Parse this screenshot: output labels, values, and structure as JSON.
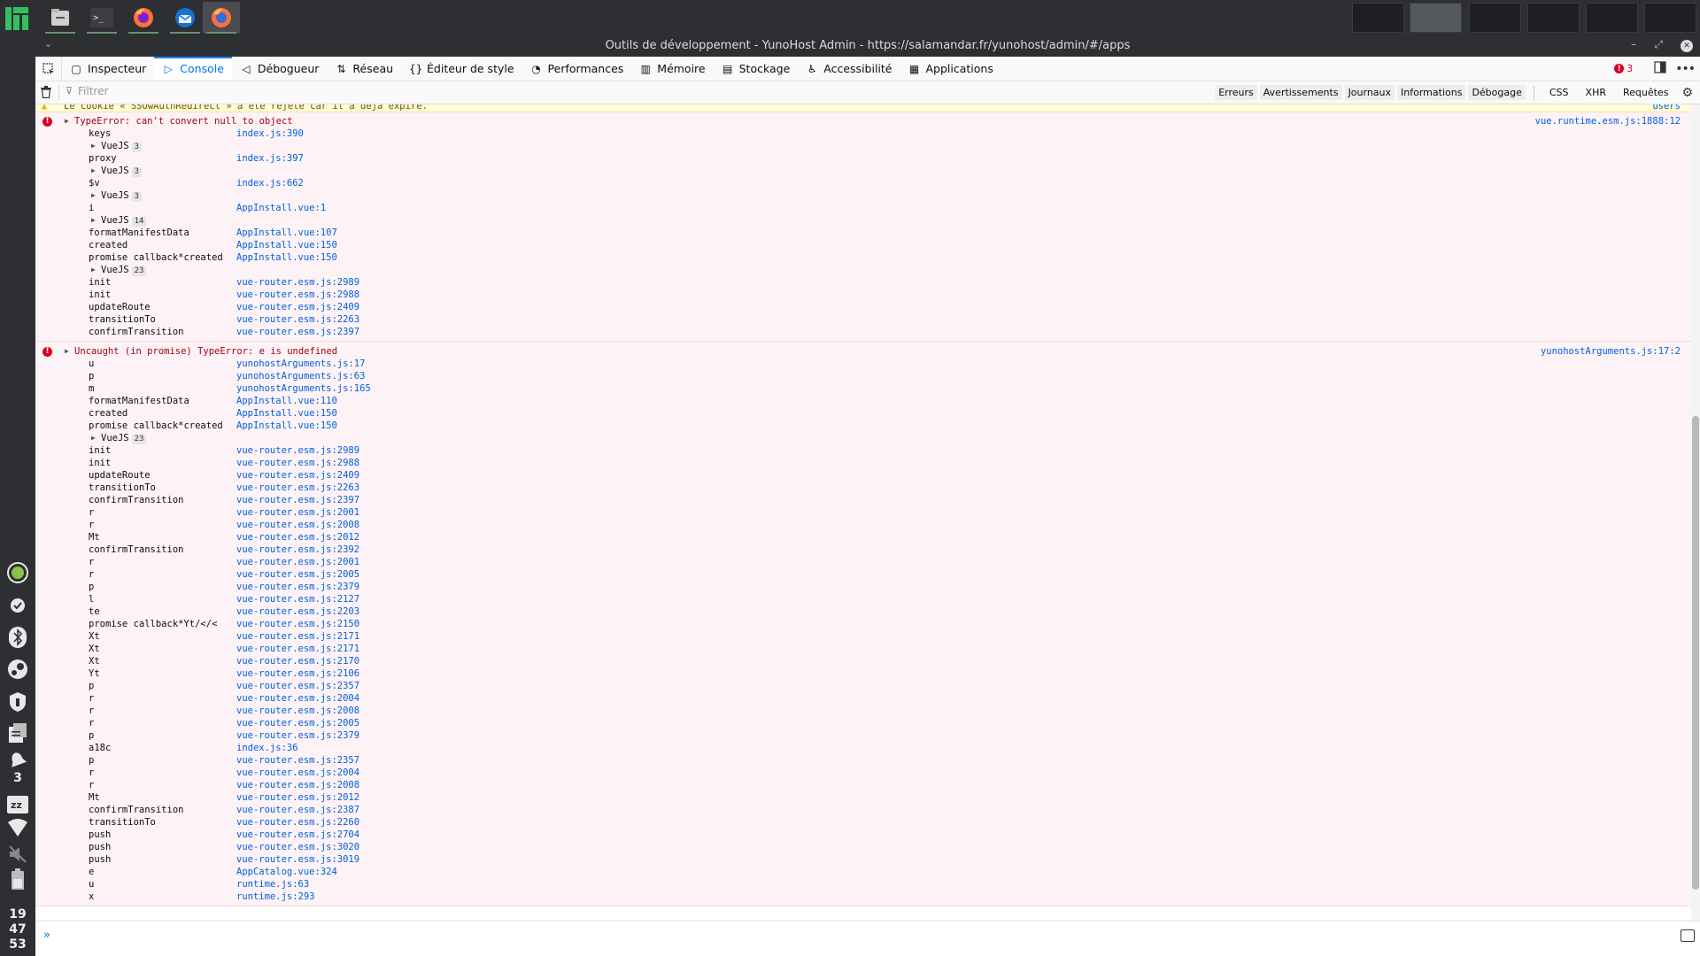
{
  "taskbar": {
    "apps": [
      {
        "name": "files-icon"
      },
      {
        "name": "terminal-icon",
        "glyph": ">_"
      },
      {
        "name": "firefox-icon"
      },
      {
        "name": "thunderbird-icon"
      },
      {
        "name": "firefox-dev-icon"
      }
    ],
    "workspaces": 6
  },
  "dock": {
    "icons": [
      "update-icon",
      "check-icon",
      "bluetooth-icon",
      "steam-icon",
      "vpn-icon",
      "clipboard-icon",
      "notifications-icon",
      "keyboard-icon",
      "wifi-icon",
      "mute-icon",
      "battery-icon"
    ],
    "notif_count": "3",
    "clock": {
      "h": "19",
      "m": "47",
      "s": "53"
    }
  },
  "window": {
    "title": "Outils de développement - YunoHost Admin - https://salamandar.fr/yunohost/admin/#/apps",
    "buttons": {
      "minimize": "–",
      "maximize": "⤢",
      "close": "✕"
    }
  },
  "toolbar": {
    "tabs": [
      {
        "label": "Inspecteur",
        "icon": "▢",
        "name": "tab-inspector"
      },
      {
        "label": "Console",
        "icon": "▷",
        "name": "tab-console",
        "selected": true
      },
      {
        "label": "Débogueur",
        "icon": "◁",
        "name": "tab-debugger"
      },
      {
        "label": "Réseau",
        "icon": "⇅",
        "name": "tab-network"
      },
      {
        "label": "Éditeur de style",
        "icon": "{}",
        "name": "tab-style-editor"
      },
      {
        "label": "Performances",
        "icon": "◔",
        "name": "tab-performance"
      },
      {
        "label": "Mémoire",
        "icon": "▥",
        "name": "tab-memory"
      },
      {
        "label": "Stockage",
        "icon": "▤",
        "name": "tab-storage"
      },
      {
        "label": "Accessibilité",
        "icon": "♿",
        "name": "tab-accessibility"
      },
      {
        "label": "Applications",
        "icon": "▦",
        "name": "tab-applications"
      }
    ],
    "error_count": "3"
  },
  "filter": {
    "placeholder": "Filtrer",
    "levels": [
      {
        "label": "Erreurs",
        "on": true
      },
      {
        "label": "Avertissements",
        "on": true
      },
      {
        "label": "Journaux",
        "on": true
      },
      {
        "label": "Informations",
        "on": true
      },
      {
        "label": "Débogage",
        "on": true
      }
    ],
    "extra": [
      "CSS",
      "XHR",
      "Requêtes"
    ]
  },
  "console": {
    "warning": {
      "text": "Le cookie « SSOwAuthRedirect » a été rejeté car il a déjà expiré.",
      "source": "users"
    },
    "errors": [
      {
        "message": "TypeError: can't convert null to object",
        "source": "vue.runtime.esm.js:1888:12",
        "frames": [
          {
            "fn": "keys",
            "src": "index.js:390"
          },
          {
            "group": "VueJS",
            "count": "3"
          },
          {
            "fn": "proxy",
            "src": "index.js:397"
          },
          {
            "group": "VueJS",
            "count": "3"
          },
          {
            "fn": "$v",
            "src": "index.js:662"
          },
          {
            "group": "VueJS",
            "count": "3"
          },
          {
            "fn": "i",
            "src": "AppInstall.vue:1"
          },
          {
            "group": "VueJS",
            "count": "14"
          },
          {
            "fn": "formatManifestData",
            "src": "AppInstall.vue:107"
          },
          {
            "fn": "created",
            "src": "AppInstall.vue:150"
          },
          {
            "fn": "promise callback*created",
            "src": "AppInstall.vue:150"
          },
          {
            "group": "VueJS",
            "count": "23"
          },
          {
            "fn": "init",
            "src": "vue-router.esm.js:2989"
          },
          {
            "fn": "init",
            "src": "vue-router.esm.js:2988"
          },
          {
            "fn": "updateRoute",
            "src": "vue-router.esm.js:2409"
          },
          {
            "fn": "transitionTo",
            "src": "vue-router.esm.js:2263"
          },
          {
            "fn": "confirmTransition",
            "src": "vue-router.esm.js:2397"
          }
        ]
      },
      {
        "message": "Uncaught (in promise) TypeError: e is undefined",
        "source": "yunohostArguments.js:17:2",
        "frames": [
          {
            "fn": "u",
            "src": "yunohostArguments.js:17"
          },
          {
            "fn": "p",
            "src": "yunohostArguments.js:63"
          },
          {
            "fn": "m",
            "src": "yunohostArguments.js:165"
          },
          {
            "fn": "formatManifestData",
            "src": "AppInstall.vue:110"
          },
          {
            "fn": "created",
            "src": "AppInstall.vue:150"
          },
          {
            "fn": "promise callback*created",
            "src": "AppInstall.vue:150"
          },
          {
            "group": "VueJS",
            "count": "23"
          },
          {
            "fn": "init",
            "src": "vue-router.esm.js:2989"
          },
          {
            "fn": "init",
            "src": "vue-router.esm.js:2988"
          },
          {
            "fn": "updateRoute",
            "src": "vue-router.esm.js:2409"
          },
          {
            "fn": "transitionTo",
            "src": "vue-router.esm.js:2263"
          },
          {
            "fn": "confirmTransition",
            "src": "vue-router.esm.js:2397"
          },
          {
            "fn": "r",
            "src": "vue-router.esm.js:2001"
          },
          {
            "fn": "r",
            "src": "vue-router.esm.js:2008"
          },
          {
            "fn": "Mt",
            "src": "vue-router.esm.js:2012"
          },
          {
            "fn": "confirmTransition",
            "src": "vue-router.esm.js:2392"
          },
          {
            "fn": "r",
            "src": "vue-router.esm.js:2001"
          },
          {
            "fn": "r",
            "src": "vue-router.esm.js:2005"
          },
          {
            "fn": "p",
            "src": "vue-router.esm.js:2379"
          },
          {
            "fn": "l",
            "src": "vue-router.esm.js:2127"
          },
          {
            "fn": "te",
            "src": "vue-router.esm.js:2203"
          },
          {
            "fn": "promise callback*Yt/</<",
            "src": "vue-router.esm.js:2150"
          },
          {
            "fn": "Xt",
            "src": "vue-router.esm.js:2171"
          },
          {
            "fn": "Xt",
            "src": "vue-router.esm.js:2171"
          },
          {
            "fn": "Xt",
            "src": "vue-router.esm.js:2170"
          },
          {
            "fn": "Yt",
            "src": "vue-router.esm.js:2106"
          },
          {
            "fn": "p",
            "src": "vue-router.esm.js:2357"
          },
          {
            "fn": "r",
            "src": "vue-router.esm.js:2004"
          },
          {
            "fn": "r",
            "src": "vue-router.esm.js:2008"
          },
          {
            "fn": "r",
            "src": "vue-router.esm.js:2005"
          },
          {
            "fn": "p",
            "src": "vue-router.esm.js:2379"
          },
          {
            "fn": "a18c",
            "src": "index.js:36"
          },
          {
            "fn": "p",
            "src": "vue-router.esm.js:2357"
          },
          {
            "fn": "r",
            "src": "vue-router.esm.js:2004"
          },
          {
            "fn": "r",
            "src": "vue-router.esm.js:2008"
          },
          {
            "fn": "Mt",
            "src": "vue-router.esm.js:2012"
          },
          {
            "fn": "confirmTransition",
            "src": "vue-router.esm.js:2387"
          },
          {
            "fn": "transitionTo",
            "src": "vue-router.esm.js:2260"
          },
          {
            "fn": "push",
            "src": "vue-router.esm.js:2704"
          },
          {
            "fn": "push",
            "src": "vue-router.esm.js:3020"
          },
          {
            "fn": "push",
            "src": "vue-router.esm.js:3019"
          },
          {
            "fn": "e",
            "src": "AppCatalog.vue:324"
          },
          {
            "fn": "u",
            "src": "runtime.js:63"
          },
          {
            "fn": "x",
            "src": "runtime.js:293"
          }
        ]
      }
    ],
    "prompt": "»"
  },
  "colors": {
    "accent": "#0a84ff",
    "error": "#d70022",
    "link": "#0060df"
  }
}
